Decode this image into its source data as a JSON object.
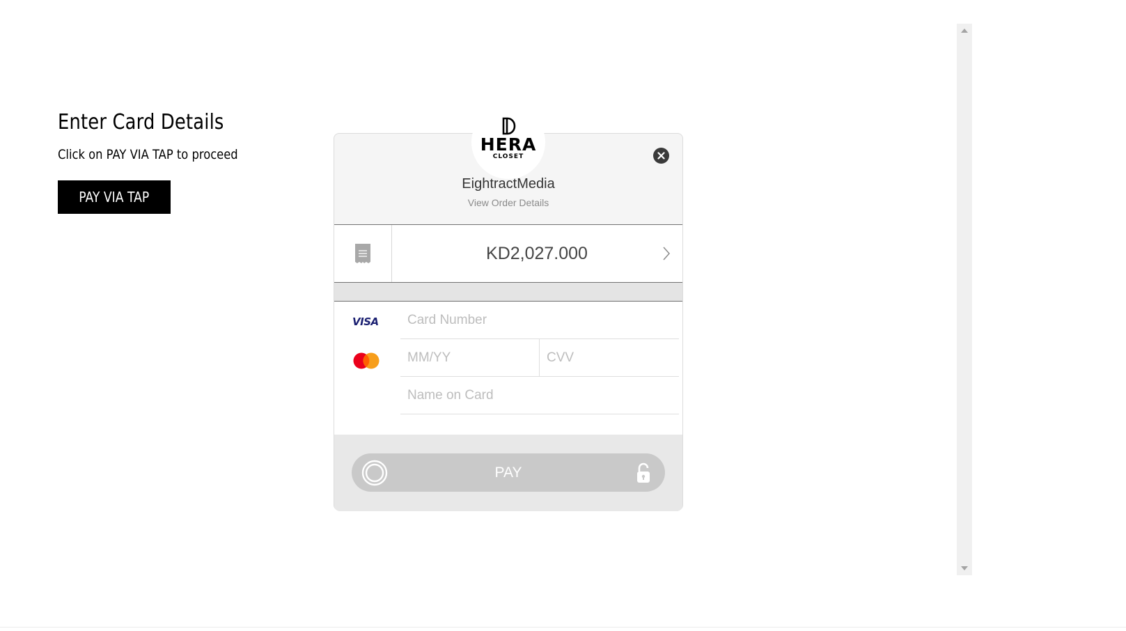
{
  "page": {
    "title": "Enter Card Details",
    "subtitle": "Click on PAY VIA TAP to proceed",
    "pay_via_tap_label": "PAY VIA TAP"
  },
  "checkout": {
    "logo_name": "HERA",
    "logo_sub": "CLOSET",
    "merchant_name": "EightractMedia",
    "order_link": "View Order Details",
    "amount": "KD2,027.000",
    "icons": {
      "close": "close-icon",
      "receipt": "receipt-icon",
      "chevron": "chevron-right-icon",
      "lock": "lock-icon"
    },
    "brands": {
      "visa": "VISA",
      "mastercard": "mastercard-icon"
    },
    "fields": {
      "card_number_placeholder": "Card Number",
      "expiry_placeholder": "MM/YY",
      "cvv_placeholder": "CVV",
      "name_placeholder": "Name on Card"
    },
    "pay_label": "PAY"
  },
  "colors": {
    "primary_button": "#000000",
    "pay_button": "#c9c9c9",
    "visa": "#1a1f71",
    "mastercard_red": "#eb001b",
    "mastercard_orange": "#f79e1b"
  }
}
